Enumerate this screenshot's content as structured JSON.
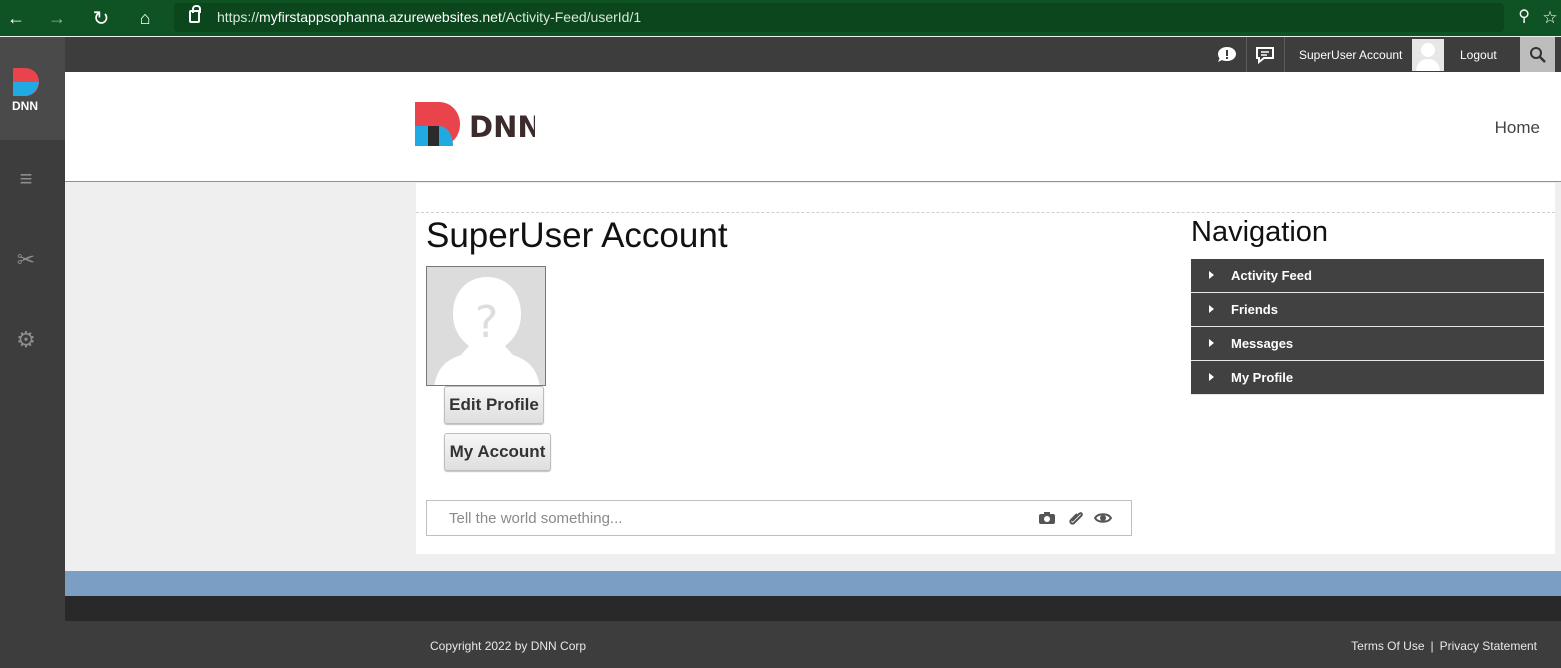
{
  "browser": {
    "url_prefix": "https://",
    "url_domain": "myfirstappsophanna.azurewebsites.net",
    "url_path": "/Activity-Feed/userId/1",
    "icons": [
      "back-arrow-icon",
      "forward-arrow-icon",
      "reload-icon",
      "home-icon",
      "lock-icon",
      "site-info-icon",
      "favorite-icon"
    ]
  },
  "top_bar": {
    "user_name": "SuperUser Account",
    "logout": "Logout"
  },
  "header": {
    "logo_text": "DNN",
    "home": "Home"
  },
  "profile": {
    "title": "SuperUser Account",
    "edit_button": "Edit Profile",
    "account_button": "My Account",
    "post_placeholder": "Tell the world something..."
  },
  "navigation": {
    "title": "Navigation",
    "items": [
      {
        "label": "Activity Feed"
      },
      {
        "label": "Friends"
      },
      {
        "label": "Messages"
      },
      {
        "label": "My Profile"
      }
    ]
  },
  "footer": {
    "copyright": "Copyright 2022 by DNN Corp",
    "terms": "Terms Of Use",
    "separator": "|",
    "privacy": "Privacy Statement"
  },
  "colors": {
    "browser_green": "#0f5224",
    "dnn_red": "#e9434b",
    "dnn_blue": "#21a9e1",
    "dark_bar": "#3d3d3d",
    "accent_blue": "#7b9ec4"
  }
}
